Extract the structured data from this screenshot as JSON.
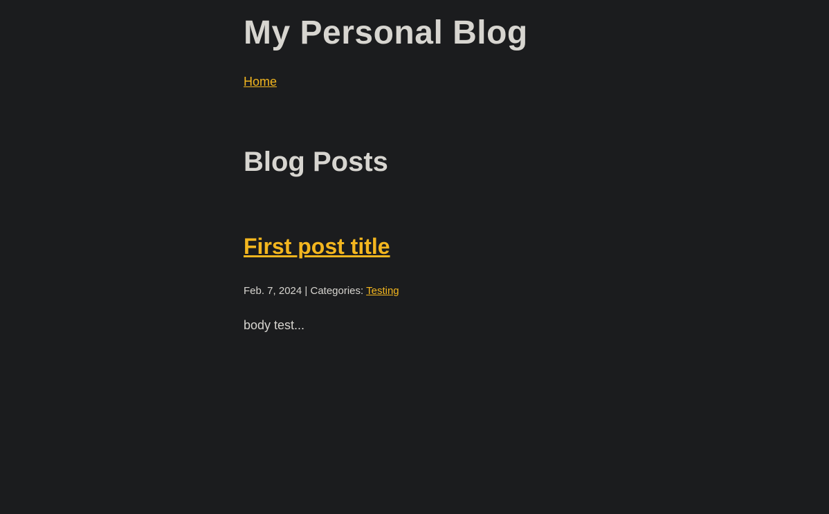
{
  "site": {
    "title": "My Personal Blog"
  },
  "nav": {
    "items": [
      {
        "label": "Home"
      }
    ]
  },
  "main": {
    "section_title": "Blog Posts",
    "posts": [
      {
        "title": "First post title",
        "date": "Feb. 7, 2024",
        "separator": "|",
        "categories_label": "Categories:",
        "categories": [
          "Testing"
        ],
        "excerpt": "body test..."
      }
    ]
  },
  "colors": {
    "background": "#1b1c1e",
    "text": "#d7d5d0",
    "accent": "#f3b61f"
  }
}
